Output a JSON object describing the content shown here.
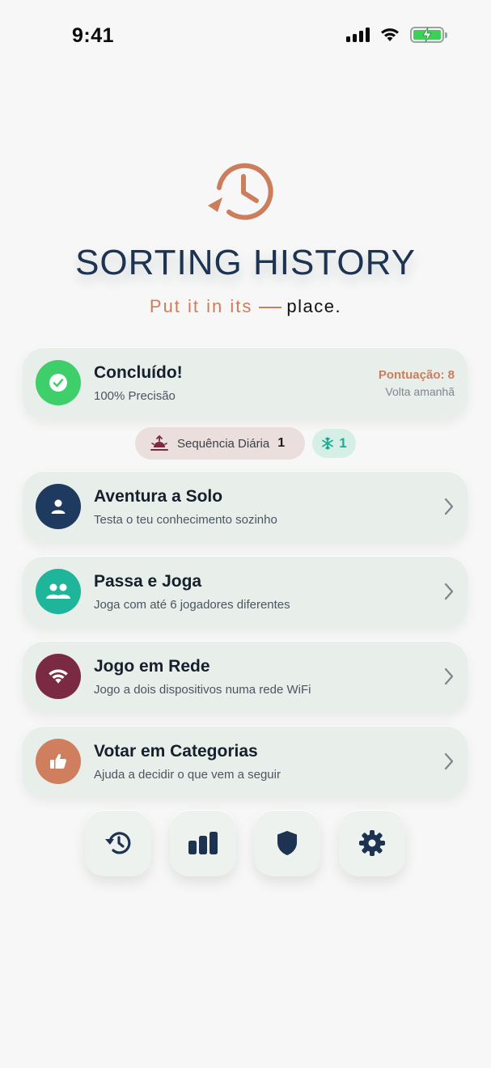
{
  "status_bar": {
    "time": "9:41"
  },
  "app": {
    "title": "SORTING HISTORY",
    "tagline_main": "Put it in its",
    "tagline_place": "place."
  },
  "result_card": {
    "title": "Concluído!",
    "subtitle": "100% Precisão",
    "score_label": "Pontuação: 8",
    "return_label": "Volta amanhã"
  },
  "streak": {
    "label": "Sequência Diária",
    "count": "1",
    "freeze_count": "1"
  },
  "modes": [
    {
      "title": "Aventura a Solo",
      "subtitle": "Testa o teu conhecimento sozinho",
      "icon": "person-icon",
      "color": "#1e3a5f"
    },
    {
      "title": "Passa e Joga",
      "subtitle": "Joga com até 6 jogadores diferentes",
      "icon": "group-icon",
      "color": "#1fb59b"
    },
    {
      "title": "Jogo em Rede",
      "subtitle": "Jogo a dois dispositivos numa rede WiFi",
      "icon": "wifi-icon",
      "color": "#7a2a42"
    },
    {
      "title": "Votar em Categorias",
      "subtitle": "Ajuda a decidir o que vem a seguir",
      "icon": "thumbs-up-icon",
      "color": "#cf7f5e"
    }
  ],
  "bottom_nav": [
    "history-icon",
    "stats-icon",
    "shield-icon",
    "settings-icon"
  ],
  "colors": {
    "accent": "#cc7d5c",
    "navy": "#1e3352",
    "success": "#3ecf5a",
    "card_bg": "#e8eeea"
  }
}
